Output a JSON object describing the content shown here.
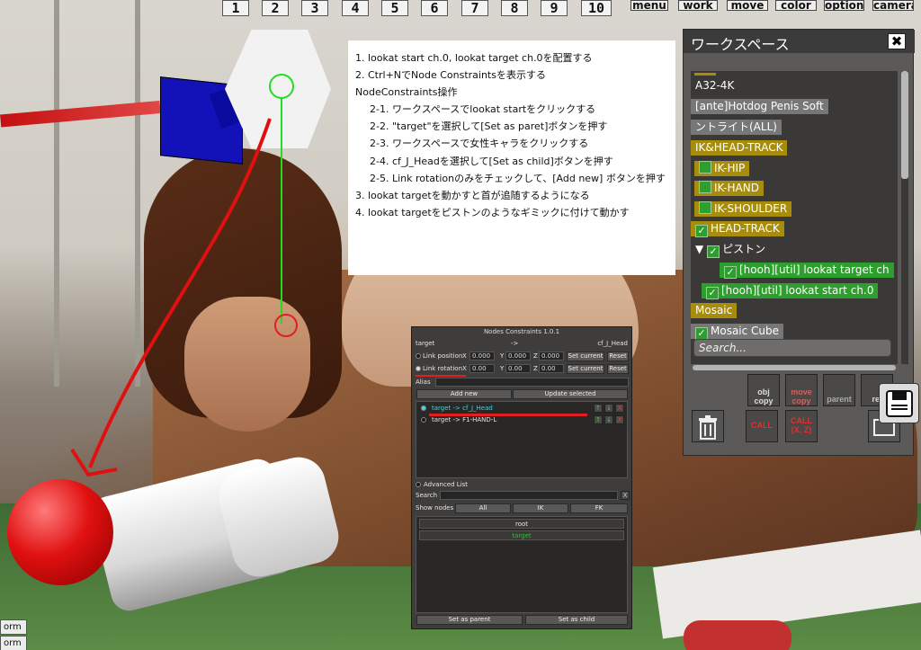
{
  "toolbar": {
    "numbers": [
      "1",
      "2",
      "3",
      "4",
      "5",
      "6",
      "7",
      "8",
      "9",
      "10"
    ],
    "menu": [
      "menu",
      "work",
      "move",
      "color",
      "option",
      "camera"
    ]
  },
  "note": {
    "lines": [
      "1. lookat start ch.0, lookat target ch.0を配置する",
      "2. Ctrl+NでNode Constraintsを表示する",
      "NodeConstraints操作",
      "2-1. ワークスペースでlookat startをクリックする",
      "2-2. \"target\"を選択して[Set as paret]ボタンを押す",
      "2-3. ワークスペースで女性キャラをクリックする",
      "2-4. cf_J_Headを選択して[Set as child]ボタンを押す",
      "2-5. Link rotationのみをチェックして、[Add new] ボタンを押す",
      "3. lookat targetを動かすと首が追随するようになる",
      "4. lookat targetをピストンのようなギミックに付けて動かす"
    ]
  },
  "nodes_constraints": {
    "title": "Nodes Constraints 1.0.1",
    "parent_label": "target",
    "arrow": "->",
    "child_label": "cf_J_Head",
    "link_position": {
      "label": "Link position",
      "x": "0.000",
      "y": "0.000",
      "z": "0.000"
    },
    "link_rotation": {
      "label": "Link rotation",
      "x": "0.00",
      "y": "0.00",
      "z": "0.00"
    },
    "axis_x": "X",
    "axis_y": "Y",
    "axis_z": "Z",
    "set_current": "Set current",
    "reset": "Reset",
    "alias_label": "Alias",
    "add_new": "Add new",
    "update_selected": "Update selected",
    "constraints": [
      "target -> cf_J_Head",
      "target -> F1-HAND-L"
    ],
    "up": "↑",
    "down": "↓",
    "remove": "X",
    "advanced_list": "Advanced List",
    "search_label": "Search",
    "search_clear": "X",
    "show_nodes_label": "Show nodes",
    "filters": [
      "All",
      "IK",
      "FK"
    ],
    "tree": [
      "root",
      "target"
    ],
    "set_as_parent": "Set as parent",
    "set_as_child": "Set as child",
    "colors": {
      "selected_text": "#38d8e8",
      "tree_selected": "#2ec02e",
      "highlight": "#e02020"
    }
  },
  "workspace": {
    "title": "ワークスペース",
    "close": "✖",
    "items": [
      {
        "label": "A32-4K",
        "style": "plain",
        "check": false
      },
      {
        "label": "[ante]Hotdog Penis Soft",
        "style": "gray",
        "check": false
      },
      {
        "label": "ントライト(ALL)",
        "style": "gray",
        "check": false
      },
      {
        "label": "IK&HEAD-TRACK",
        "style": "gold",
        "check": false
      },
      {
        "label": "IK-HIP",
        "style": "gold",
        "check": true
      },
      {
        "label": "IK-HAND",
        "style": "gold",
        "check": true
      },
      {
        "label": "IK-SHOULDER",
        "style": "gold",
        "check": true
      },
      {
        "label": "HEAD-TRACK",
        "style": "gold",
        "check": true
      },
      {
        "label": "ピストン",
        "style": "plain",
        "check": true
      },
      {
        "label": "[hooh][util] lookat target ch",
        "style": "green",
        "check": true
      },
      {
        "label": "[hooh][util] lookat start ch.0",
        "style": "green",
        "check": true
      },
      {
        "label": "Mosaic",
        "style": "gold",
        "check": false
      },
      {
        "label": "Mosaic Cube",
        "style": "gray",
        "check": true
      }
    ],
    "search_placeholder": "Search...",
    "buttons": {
      "obj_copy": "obj copy",
      "move_copy": "move copy",
      "parent": "parent",
      "rel": "rel",
      "call": "CALL",
      "call_xz": "CALL (X, Z)"
    }
  },
  "bottom": {
    "btn1": "orm",
    "btn2": "orm"
  }
}
